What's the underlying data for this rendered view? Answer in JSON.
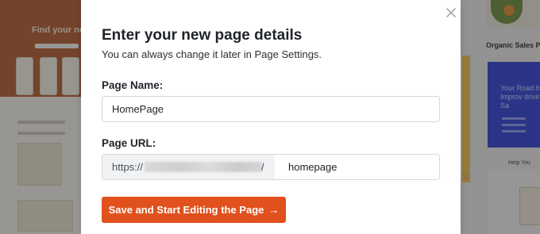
{
  "background": {
    "left_hero_heading": "Find your next",
    "right_card_label": "Organic Sales Pa",
    "blue_card_text": "Your Road for Improv driving Sa",
    "help_text": "Help You"
  },
  "modal": {
    "title": "Enter your new page details",
    "subtitle": "You can always change it later in Page Settings.",
    "page_name": {
      "label": "Page Name:",
      "value": "HomePage"
    },
    "page_url": {
      "label": "Page URL:",
      "prefix": "https://",
      "separator": "/",
      "slug": "homepage"
    },
    "save_button": {
      "label": "Save and Start Editing the Page",
      "arrow": "→"
    },
    "close_icon": "close-icon"
  },
  "colors": {
    "accent": "#e0511d",
    "overlay": "rgba(40,40,40,0.45)"
  }
}
